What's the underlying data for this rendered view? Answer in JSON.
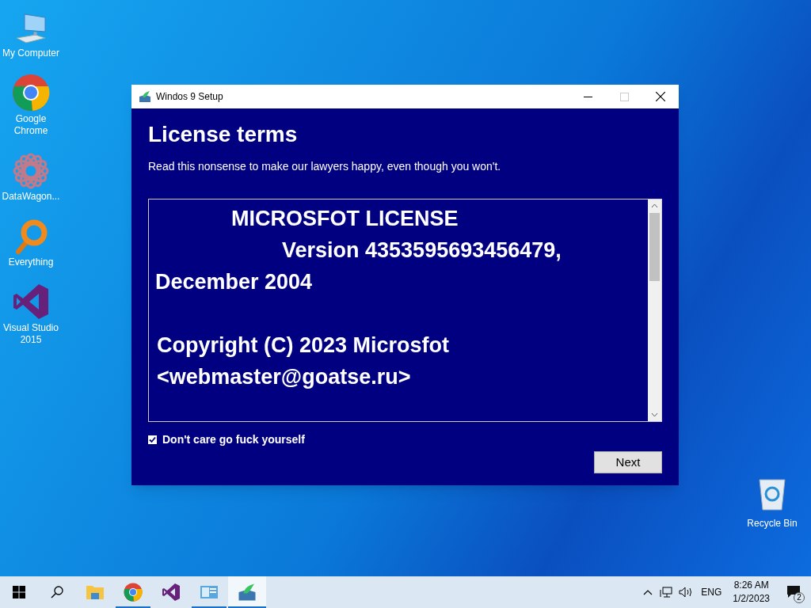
{
  "desktop_icons": [
    {
      "kind": "computer",
      "label": "My Computer"
    },
    {
      "kind": "chrome",
      "label": "Google Chrome"
    },
    {
      "kind": "datawagon",
      "label": "DataWagon..."
    },
    {
      "kind": "everything",
      "label": "Everything"
    },
    {
      "kind": "vs",
      "label": "Visual Studio 2015"
    }
  ],
  "recycle_bin": {
    "label": "Recycle Bin"
  },
  "window": {
    "title": "Windos 9 Setup",
    "heading": "License terms",
    "subtitle": "Read this nonsense to make our lawyers happy, even though you won't.",
    "license": [
      {
        "kind": "title",
        "text": "MICROSFOT LICENSE"
      },
      {
        "kind": "indented",
        "text": "Version 4353595693456479, December 2004"
      },
      {
        "kind": "gap",
        "text": "Copyright (C) 2023 Microsfot <webmaster@goatse.ru>"
      }
    ],
    "checkbox": {
      "label": "Don't care go fuck yourself",
      "checked": true
    },
    "next_button": "Next"
  },
  "taskbar": {
    "apps": [
      {
        "kind": "explorer",
        "running": false,
        "selected": false
      },
      {
        "kind": "chrome",
        "running": true,
        "selected": false
      },
      {
        "kind": "vs",
        "running": false,
        "selected": false
      },
      {
        "kind": "panel",
        "running": true,
        "selected": false
      },
      {
        "kind": "setup",
        "running": true,
        "selected": true
      }
    ],
    "language": "ENG",
    "time": "8:26 AM",
    "date": "1/2/2023",
    "notifications": "2"
  }
}
